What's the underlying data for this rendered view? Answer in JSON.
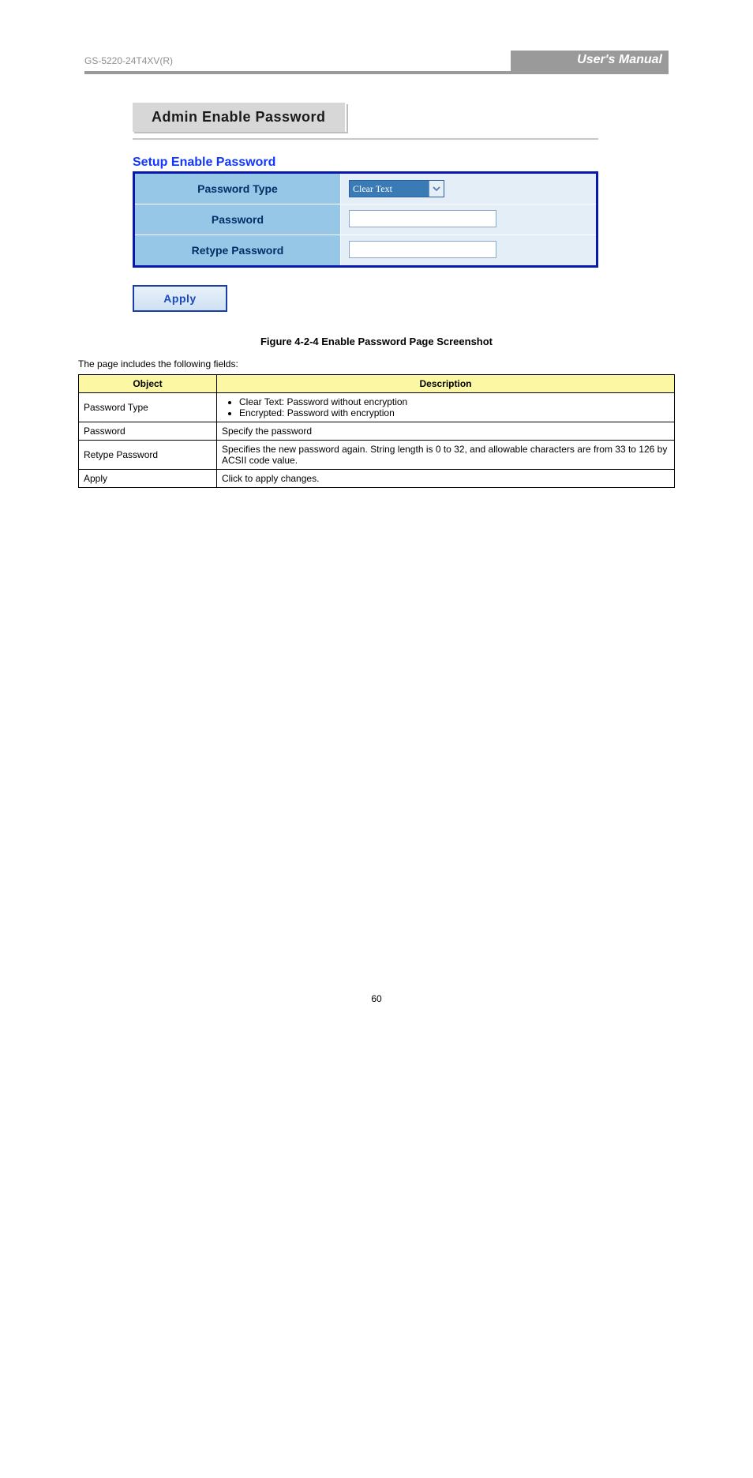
{
  "header": {
    "model": "GS-5220-24T4XV(R)",
    "brand": "User's Manual"
  },
  "panel": {
    "title": "Admin Enable Password",
    "section_title": "Setup Enable Password",
    "rows": {
      "password_type_label": "Password Type",
      "password_type_value": "Clear Text",
      "password_label": "Password",
      "retype_password_label": "Retype Password"
    },
    "apply_label": "Apply"
  },
  "figure_caption": "Figure 4-2-4 Enable Password Page Screenshot",
  "intro_line": "The page includes the following fields:",
  "desc": {
    "headers": {
      "object": "Object",
      "description": "Description"
    },
    "rows": [
      {
        "object": "Password Type",
        "bullets": [
          "Clear Text: Password without encryption",
          "Encrypted: Password with encryption"
        ]
      },
      {
        "object": "Password",
        "text": "Specify the password"
      },
      {
        "object": "Retype Password",
        "text": "Specifies the new password again. String length is 0 to 32, and allowable characters are from 33 to 126 by ACSII code value."
      },
      {
        "object": "Apply",
        "text": "Click to apply changes."
      }
    ]
  },
  "page_number": "60"
}
